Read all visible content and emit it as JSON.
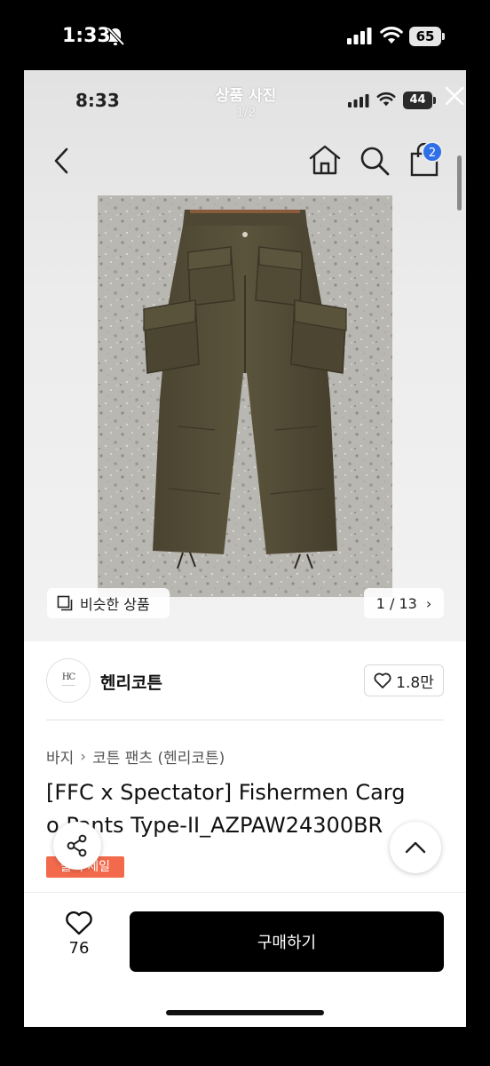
{
  "outer_status": {
    "time": "1:33",
    "battery": "65"
  },
  "inner_status": {
    "time": "8:33",
    "battery": "44"
  },
  "viewer": {
    "title": "상품 사진",
    "counter": "1/2"
  },
  "header": {
    "cart_badge": "2"
  },
  "photo": {
    "similar_label": "비슷한 상품",
    "page_counter": "1 / 13"
  },
  "brand": {
    "name": "헨리코튼",
    "like_count": "1.8만"
  },
  "breadcrumb": {
    "level1": "바지",
    "level2": "코튼 팬츠 (헨리코튼)"
  },
  "product": {
    "title_line1": "[FFC x Spectator] Fishermen Carg",
    "title_line2": "o Pants Type-II_AZPAW24300BR",
    "sale_badge": "블랙 세일"
  },
  "bottom": {
    "wish_count": "76",
    "buy_label": "구매하기"
  },
  "colors": {
    "buy_button": "#000000",
    "sale_badge": "#f26a4b",
    "cart_badge": "#2f6fe8"
  }
}
